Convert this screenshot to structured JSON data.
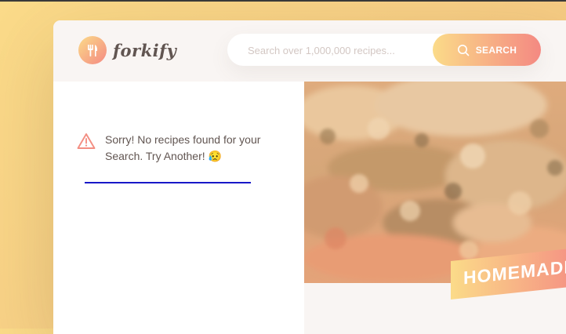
{
  "header": {
    "logo": {
      "text": "forkify"
    },
    "search": {
      "placeholder": "Search over 1,000,000 recipes...",
      "value": "",
      "button_label": "SEARCH"
    }
  },
  "results": {
    "error_message": "Sorry! No recipes found for your Search. Try Another! 😥"
  },
  "recipe": {
    "title": "HOMEMADE"
  },
  "colors": {
    "accent_start": "#fbdb89",
    "accent_end": "#f48982",
    "text": "#615551",
    "error_icon": "#f38e82",
    "underline": "#1818c8"
  },
  "icons": {
    "logo": "fork-knife-icon",
    "search": "search-icon",
    "error": "alert-triangle-icon"
  }
}
